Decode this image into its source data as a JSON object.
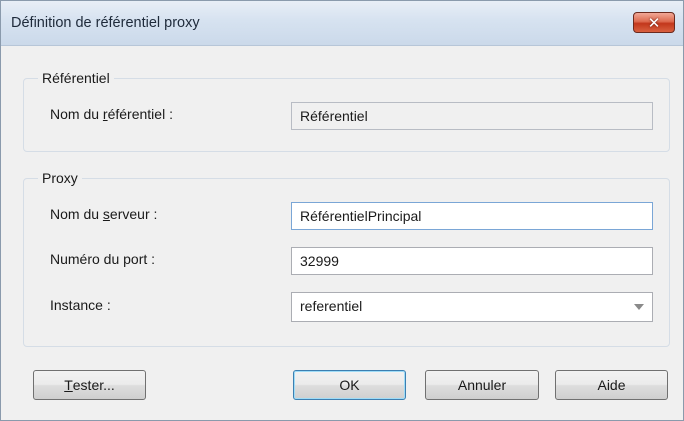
{
  "window": {
    "title": "Définition de référentiel proxy",
    "close_symbol": "✕"
  },
  "group_referentiel": {
    "label": "Référentiel",
    "name_label_pre": "Nom du ",
    "name_label_mnemonic": "r",
    "name_label_post": "éférentiel :",
    "name_value": "Référentiel"
  },
  "group_proxy": {
    "label": "Proxy",
    "server_label_pre": "Nom du ",
    "server_label_mnemonic": "s",
    "server_label_post": "erveur :",
    "server_value": "RéférentielPrincipal",
    "port_label": "Numéro du port :",
    "port_value": "32999",
    "instance_label": "Instance :",
    "instance_value": "referentiel"
  },
  "buttons": {
    "test_mnemonic": "T",
    "test_rest": "ester...",
    "ok": "OK",
    "cancel": "Annuler",
    "help": "Aide"
  },
  "icons": {
    "close": "close-icon",
    "dropdown": "chevron-down-icon"
  }
}
